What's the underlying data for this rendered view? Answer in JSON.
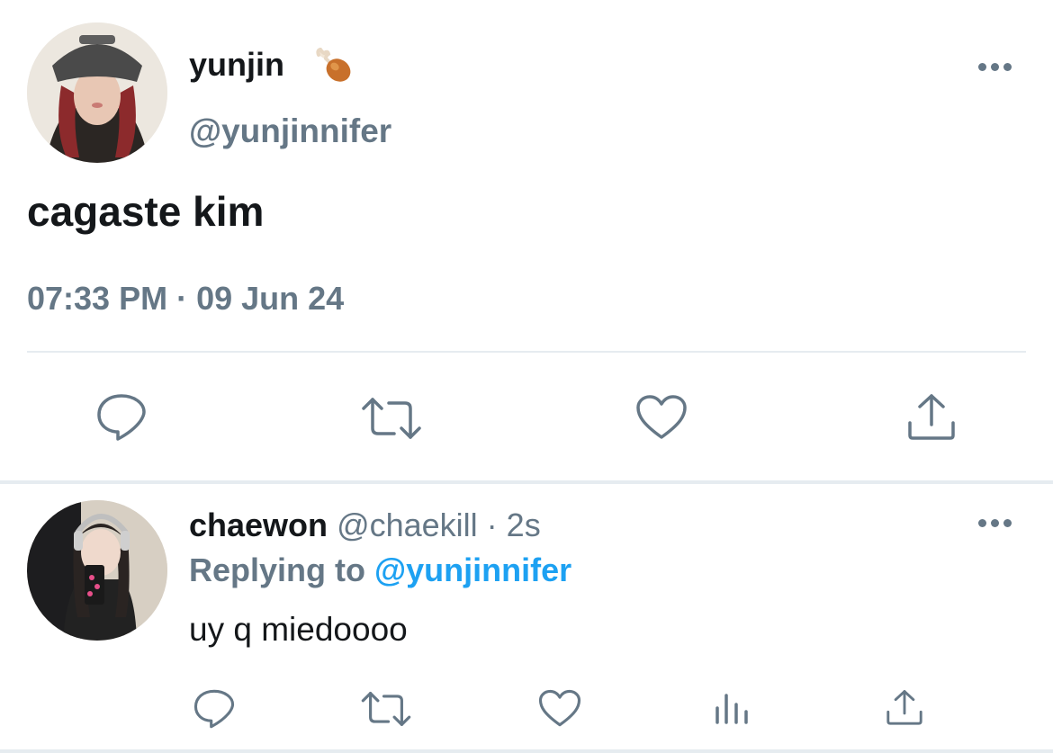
{
  "main_tweet": {
    "display_name": "yunjin",
    "name_emoji": "drumstick-icon",
    "handle": "@yunjinnifer",
    "text": "cagaste kim",
    "timestamp": "07:33 PM · 09 Jun 24",
    "actions": [
      "reply",
      "retweet",
      "like",
      "share"
    ]
  },
  "reply": {
    "display_name": "chaewon",
    "handle": "@chaekill",
    "separator": " · ",
    "time_ago": "2s",
    "replying_prefix": "Replying to ",
    "replying_to": "@yunjinnifer",
    "text": "uy q miedoooo",
    "actions": [
      "reply",
      "retweet",
      "like",
      "views",
      "share"
    ]
  },
  "colors": {
    "text": "#14171a",
    "secondary": "#657786",
    "accent": "#1da1f2",
    "divider": "#e6ecf0"
  }
}
